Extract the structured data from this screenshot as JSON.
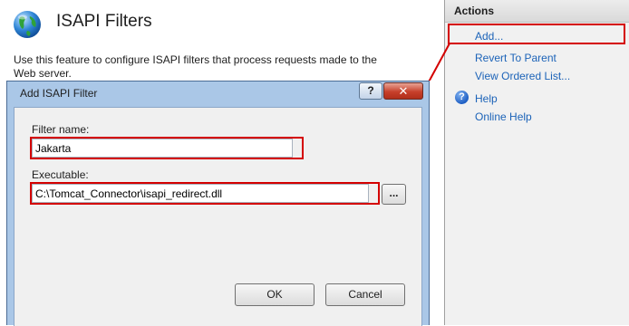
{
  "page": {
    "title": "ISAPI Filters",
    "description": "Use this feature to configure ISAPI filters that process requests made to the Web server.",
    "icon": "globe-icon"
  },
  "actions": {
    "header": "Actions",
    "items": [
      {
        "label": "Add...",
        "icon": ""
      },
      {
        "label": "Revert To Parent",
        "icon": ""
      },
      {
        "label": "View Ordered List...",
        "icon": ""
      },
      {
        "label": "Help",
        "icon": "help-icon"
      },
      {
        "label": "Online Help",
        "icon": ""
      }
    ]
  },
  "dialog": {
    "title": "Add ISAPI Filter",
    "help_button": "?",
    "close_button": "✕",
    "filter_name_label": "Filter name:",
    "filter_name_value": "Jakarta",
    "executable_label": "Executable:",
    "executable_value": "C:\\Tomcat_Connector\\isapi_redirect.dll",
    "browse_button": "...",
    "ok_button": "OK",
    "cancel_button": "Cancel"
  },
  "colors": {
    "highlight": "#d40000",
    "link": "#1c63b8",
    "dialog_frame": "#aac7e7"
  }
}
